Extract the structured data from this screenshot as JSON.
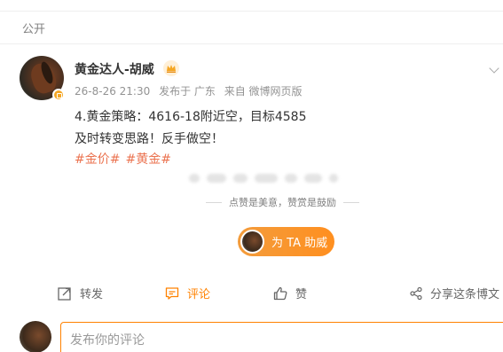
{
  "feed": {
    "visibility_label": "公开"
  },
  "post": {
    "author": "黄金达人-胡威",
    "timestamp": "26-8-26 21:30",
    "location": "发布于 广东",
    "source": "来自 微博网页版",
    "content_lines": [
      "4.黄金策略：4616-18附近空，目标4585",
      "及时转变思路！反手做空！"
    ],
    "tags": [
      "#金价#",
      "#黄金#"
    ],
    "verified_badge_color": "#f5a623"
  },
  "reward": {
    "caption": "点赞是美意，赞赏是鼓励",
    "button_label": "为 TA 助威",
    "button_color": "#ff8f1f"
  },
  "actions": {
    "repost_label": "转发",
    "comment_label": "评论",
    "like_label": "赞",
    "share_label": "分享这条博文",
    "active_color": "#ff8200"
  },
  "comment_box": {
    "placeholder": "发布你的评论"
  }
}
